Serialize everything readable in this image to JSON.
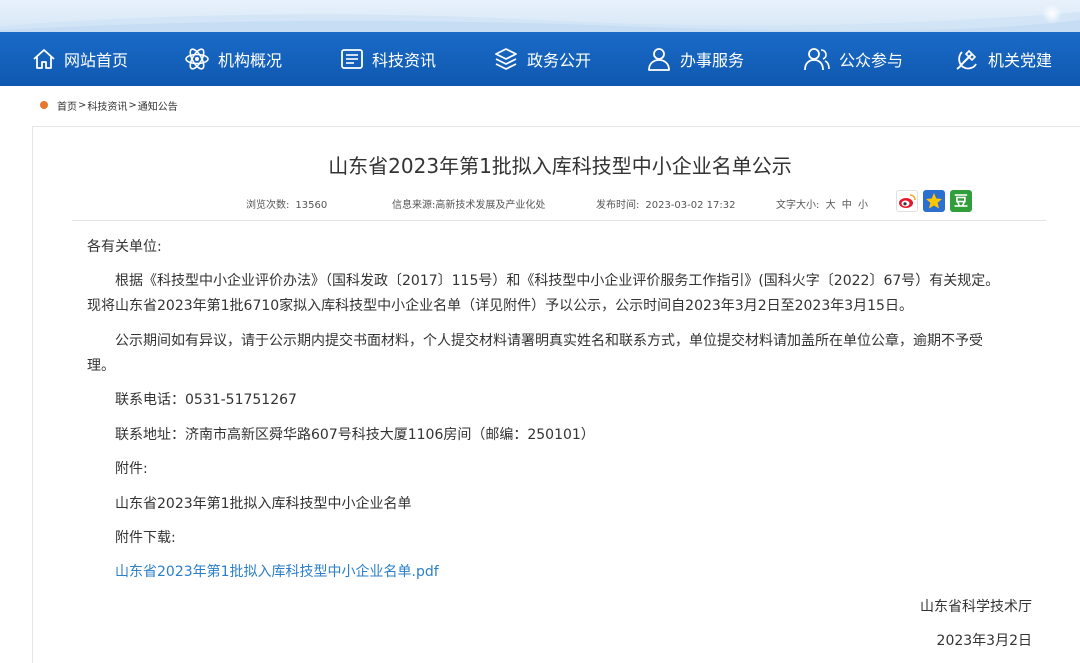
{
  "nav": {
    "items": [
      {
        "label": "网站首页",
        "icon": "home-icon"
      },
      {
        "label": "机构概况",
        "icon": "atom-icon"
      },
      {
        "label": "科技资讯",
        "icon": "news-icon"
      },
      {
        "label": "政务公开",
        "icon": "layers-icon"
      },
      {
        "label": "办事服务",
        "icon": "user-icon"
      },
      {
        "label": "公众参与",
        "icon": "users-icon"
      },
      {
        "label": "机关党建",
        "icon": "party-emblem-icon"
      }
    ]
  },
  "breadcrumb": {
    "home": "首页",
    "sep": ">",
    "section": "科技资讯",
    "current": "通知公告"
  },
  "article": {
    "title": "山东省2023年第1批拟入库科技型中小企业名单公示",
    "meta": {
      "views_label": "浏览次数:",
      "views": "13560",
      "source_label": "信息来源:",
      "source": "高新技术发展及产业化处",
      "time_label": "发布时间:",
      "time": "2023-03-02 17:32",
      "font_label": "文字大小:",
      "font_large": "大",
      "font_medium": "中",
      "font_small": "小"
    },
    "share": {
      "weibo": "weibo-icon",
      "qzone": "qzone-star-icon",
      "douban": "豆"
    },
    "salutation": "各有关单位:",
    "para1_line1": "根据《科技型中小企业评价办法》（国科发政〔2017〕115号）和《科技型中小企业评价服务工作指引》(国科火字〔2022〕67号）有关规定。",
    "para1_line2": "现将山东省2023年第1批6710家拟入库科技型中小企业名单（详见附件）予以公示，公示时间自2023年3月2日至2023年3月15日。",
    "para2_line1": "公示期间如有异议，请于公示期内提交书面材料，个人提交材料请署明真实姓名和联系方式，单位提交材料请加盖所在单位公章，逾期不予受",
    "para2_line2": "理。",
    "phone": "联系电话：0531-51751267",
    "address": "联系地址：济南市高新区舜华路607号科技大厦1106房间（邮编：250101）",
    "attachment_label": "附件:",
    "attachment_name": "山东省2023年第1批拟入库科技型中小企业名单",
    "download_label": "附件下载:",
    "download_link": "山东省2023年第1批拟入库科技型中小企业名单.pdf",
    "signature": "山东省科学技术厅",
    "date": "2023年3月2日"
  },
  "colors": {
    "nav_bg": "#1a6bc7",
    "link": "#2b7fc9",
    "breadcrumb_dot": "#e8772e"
  }
}
